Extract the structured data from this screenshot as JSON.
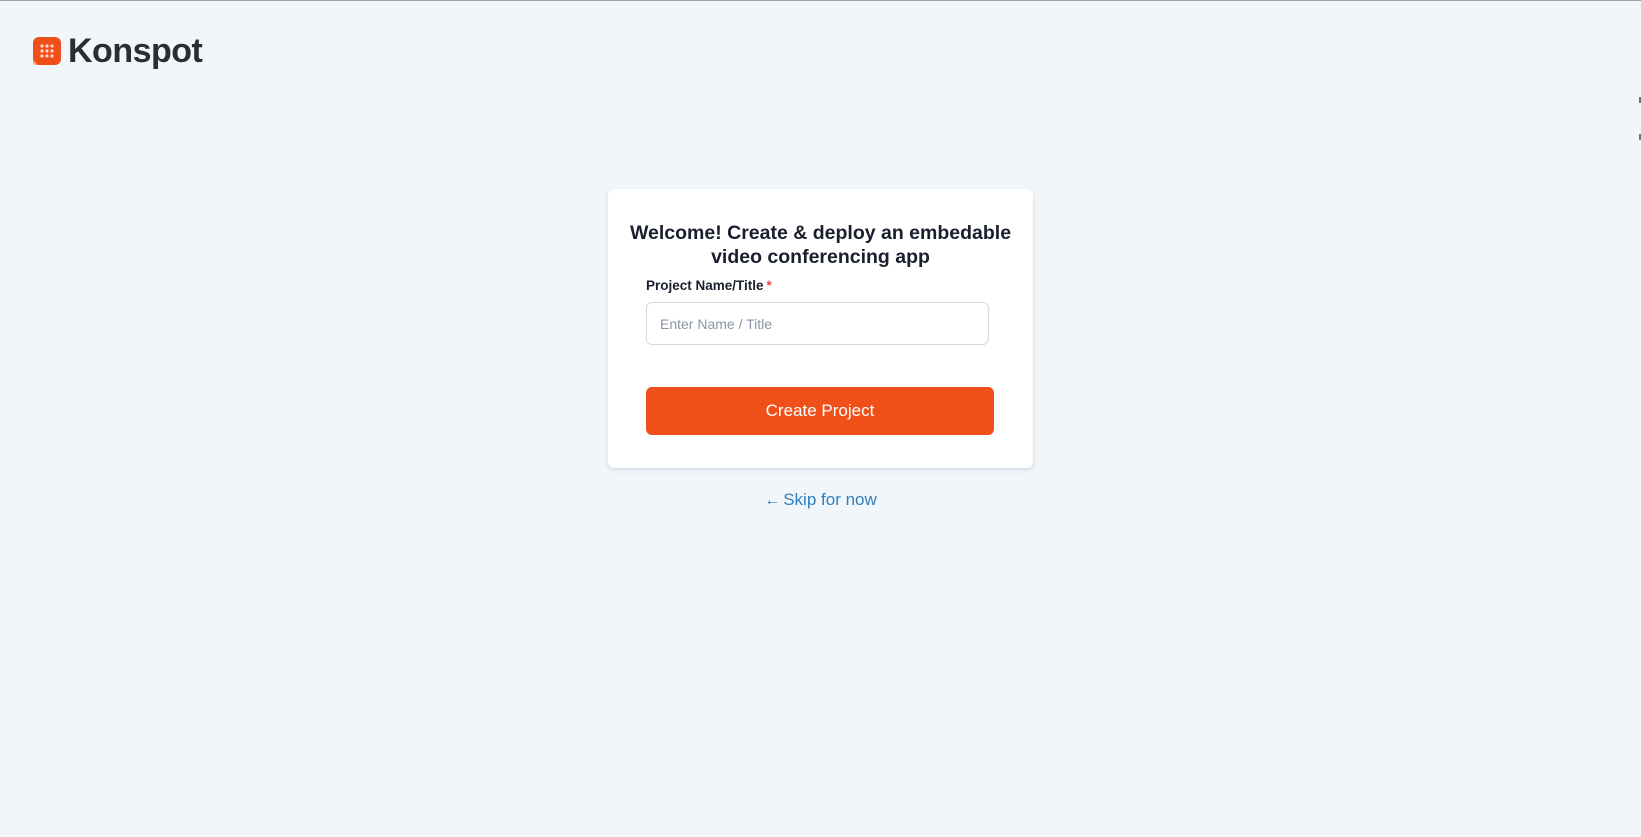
{
  "brand": {
    "name": "Konspot",
    "logo_icon": "konspot-logo-icon",
    "accent_color": "#f04f1a"
  },
  "card": {
    "title": "Welcome! Create & deploy an embedable video conferencing app",
    "field": {
      "label": "Project Name/Title",
      "required_marker": "*",
      "value": "",
      "placeholder": "Enter Name / Title"
    },
    "submit_label": "Create Project"
  },
  "skip": {
    "icon": "arrow-left-icon",
    "label": "Skip for now",
    "color": "#2f7fbf"
  }
}
